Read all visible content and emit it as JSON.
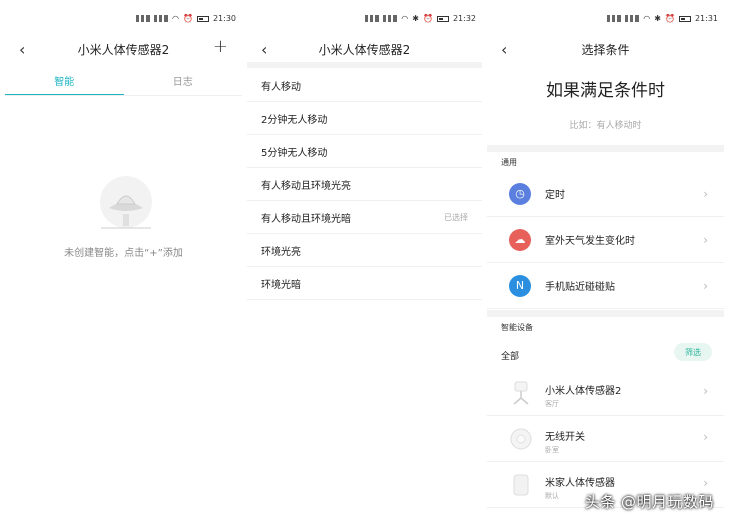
{
  "screen1": {
    "time": "21:30",
    "title": "小米人体传感器2",
    "plus": "+",
    "tabs": [
      {
        "label": "智能"
      },
      {
        "label": "日志"
      }
    ],
    "empty_text": "未创建智能，点击“+”添加"
  },
  "screen2": {
    "time": "21:32",
    "title": "小米人体传感器2",
    "conditions": [
      {
        "label": "有人移动",
        "tag": ""
      },
      {
        "label": "2分钟无人移动",
        "tag": ""
      },
      {
        "label": "5分钟无人移动",
        "tag": ""
      },
      {
        "label": "有人移动且环境光亮",
        "tag": ""
      },
      {
        "label": "有人移动且环境光暗",
        "tag": "已选择"
      },
      {
        "label": "环境光亮",
        "tag": ""
      },
      {
        "label": "环境光暗",
        "tag": ""
      }
    ]
  },
  "screen3": {
    "time": "21:31",
    "title": "选择条件",
    "heading": "如果满足条件时",
    "hint": "比如：有人移动时",
    "general_label": "通用",
    "general": [
      {
        "label": "定时",
        "icon": "clock-icon",
        "color": "#5b7fde"
      },
      {
        "label": "室外天气发生变化时",
        "icon": "weather-icon",
        "color": "#e8605a"
      },
      {
        "label": "手机贴近碰碰贴",
        "icon": "nfc-icon",
        "color": "#2a8fe0"
      }
    ],
    "devices_label": "智能设备",
    "all_label": "全部",
    "filter_label": "筛选",
    "devices": [
      {
        "name": "小米人体传感器2",
        "room": "客厅"
      },
      {
        "name": "无线开关",
        "room": "卧室"
      },
      {
        "name": "米家人体传感器",
        "room": "默认"
      }
    ]
  },
  "watermark": "头条 @明月玩数码"
}
